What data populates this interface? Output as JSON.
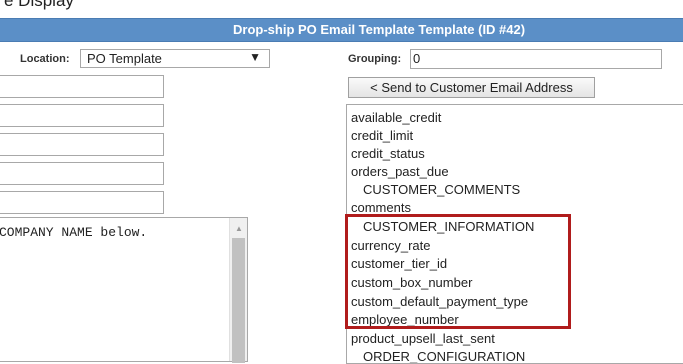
{
  "header": {
    "top_text": "e Display",
    "title": "Drop-ship PO Email Template Template (ID #42)"
  },
  "location": {
    "label": "Location:",
    "value": "PO Template",
    "arrow": "▼"
  },
  "grouping": {
    "label": "Grouping:",
    "value": "0"
  },
  "send_button": {
    "label": "< Send to Customer Email Address"
  },
  "left_fields": [
    "",
    "",
    "",
    "",
    ""
  ],
  "body_text": "COMPANY NAME below.",
  "field_list": {
    "items": [
      "available_credit",
      "credit_limit",
      "credit_status",
      "orders_past_due",
      "CUSTOMER_COMMENTS",
      "comments",
      "CUSTOMER_INFORMATION",
      "currency_rate",
      "customer_tier_id",
      "custom_box_number",
      "custom_default_payment_type",
      "employee_number",
      "product_upsell_last_sent",
      "ORDER_CONFIGURATION"
    ]
  },
  "colors": {
    "title_bar": "#5b8fc7",
    "highlight": "#b01c1c"
  }
}
